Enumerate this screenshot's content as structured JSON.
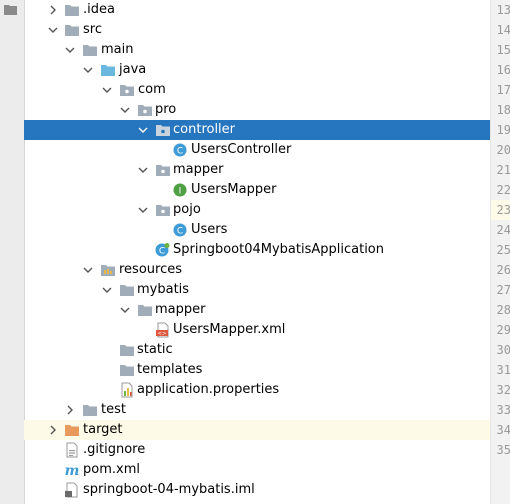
{
  "tree": {
    "folders": {
      "idea": ".idea",
      "src": "src",
      "main": "main",
      "java": "java",
      "com": "com",
      "pro": "pro",
      "controller": "controller",
      "mapper": "mapper",
      "pojo": "pojo",
      "resources": "resources",
      "mybatis": "mybatis",
      "mybatis_mapper": "mapper",
      "static": "static",
      "templates": "templates",
      "test": "test",
      "target": "target"
    },
    "files": {
      "users_controller": "UsersController",
      "users_mapper": "UsersMapper",
      "users": "Users",
      "application_class": "Springboot04MybatisApplication",
      "users_mapper_xml": "UsersMapper.xml",
      "application_properties": "application.properties",
      "gitignore": ".gitignore",
      "pom": "pom.xml",
      "iml": "springboot-04-mybatis.iml"
    },
    "selected": "controller",
    "icon_badges": {
      "class": "C",
      "interface": "I",
      "xml": "<>",
      "maven": "m"
    }
  },
  "gutter": {
    "line_numbers": [
      "13",
      "14",
      "15",
      "16",
      "17",
      "18",
      "19",
      "20",
      "21",
      "22",
      "23",
      "24",
      "25",
      "26",
      "27",
      "28",
      "29",
      "30",
      "31",
      "32",
      "33",
      "34",
      "35"
    ],
    "current_line": "22"
  },
  "colors": {
    "selection": "#2675bf",
    "folder": "#a0acb8",
    "source_folder": "#6ab7e0",
    "excluded_folder": "#e89a5c",
    "class_icon": "#3d9bd6",
    "interface_icon": "#4f9f45",
    "current_line_bg": "#fdfae7"
  }
}
